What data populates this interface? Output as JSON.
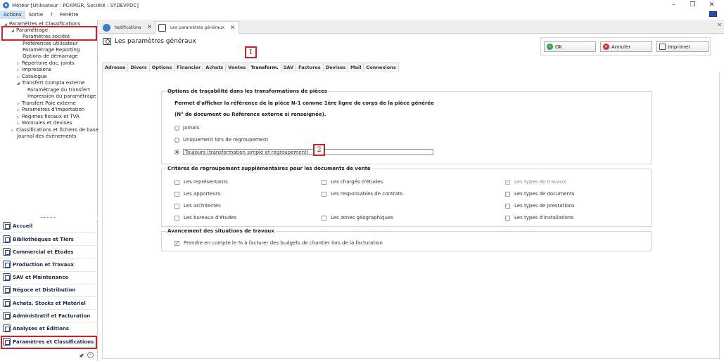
{
  "window": {
    "title": "Météor [Utilisateur : PCKMGR, Société : SYDEVPDC]",
    "minimize": "–",
    "maximize": "❐",
    "close": "✕"
  },
  "menu": {
    "items": [
      {
        "label": "Actions"
      },
      {
        "label": "Sortie"
      },
      {
        "label": "?"
      },
      {
        "label": "Fenêtre"
      }
    ]
  },
  "tree": {
    "rows": [
      {
        "label": "Paramètres et Classifications",
        "expander": "◢"
      },
      {
        "label": "Paramétrage",
        "expander": "◢"
      },
      {
        "label": "Paramètres société",
        "expander": ""
      },
      {
        "label": "Préférences utilisateur",
        "expander": ""
      },
      {
        "label": "Paramétrage Reporting",
        "expander": ""
      },
      {
        "label": "Options de démarrage",
        "expander": ""
      },
      {
        "label": "Répertoire doc. joints",
        "expander": "▷"
      },
      {
        "label": "Impressions",
        "expander": "▷"
      },
      {
        "label": "Catalogue",
        "expander": "▷"
      },
      {
        "label": "Transfert Compta externe",
        "expander": "◢"
      },
      {
        "label": "Paramétrage du transfert",
        "expander": ""
      },
      {
        "label": "Impression du paramétrage",
        "expander": ""
      },
      {
        "label": "Transfert Paie externe",
        "expander": "▷"
      },
      {
        "label": "Paramètres d'importation",
        "expander": "▷"
      },
      {
        "label": "Régimes fiscaux et TVA",
        "expander": "▷"
      },
      {
        "label": "Monnaies et devises",
        "expander": "▷"
      },
      {
        "label": "Classifications et fichiers de base",
        "expander": "▷"
      },
      {
        "label": "Journal des événements",
        "expander": ""
      }
    ]
  },
  "nav": {
    "items": [
      {
        "label": "Accueil"
      },
      {
        "label": "Bibliothèques et Tiers"
      },
      {
        "label": "Commercial et Études"
      },
      {
        "label": "Production et Travaux"
      },
      {
        "label": "SAV et Maintenance"
      },
      {
        "label": "Négoce et Distribution"
      },
      {
        "label": "Achats, Stocks et Matériel"
      },
      {
        "label": "Administratif et Facturation"
      },
      {
        "label": "Analyses et Éditions"
      },
      {
        "label": "Paramètres et Classifications"
      }
    ],
    "pin_glyph": "🖈",
    "collapse_glyph": "«"
  },
  "tabs": [
    {
      "label": "Notifications",
      "close": "✕"
    },
    {
      "label": "Les paramètres généraux",
      "close": "✕"
    }
  ],
  "tabstrip_close": "✕",
  "page": {
    "title": "Les paramètres généraux",
    "ok_label": "OK",
    "ok_glyph": "✓",
    "cancel_label": "Annuler",
    "cancel_glyph": "✕",
    "print_label": "Imprimer",
    "badge1": "1",
    "badge2": "2"
  },
  "subtabs": [
    {
      "label": "Adresse"
    },
    {
      "label": "Divers"
    },
    {
      "label": "Options"
    },
    {
      "label": "Financier"
    },
    {
      "label": "Achats"
    },
    {
      "label": "Ventes"
    },
    {
      "label": "Transform."
    },
    {
      "label": "SAV"
    },
    {
      "label": "Factures"
    },
    {
      "label": "Devises"
    },
    {
      "label": "Mail"
    },
    {
      "label": "Connexions"
    }
  ],
  "trace": {
    "legend": "Options de traçabilité dans les transformations de pièces",
    "desc1": "Permet d'afficher la référence de la pièce N-1 comme 1ère ligne de corps de la pièce générée",
    "desc2": "(N° de document ou Référence externe si renseignée).",
    "options": [
      {
        "label": "Jamais",
        "checked": false
      },
      {
        "label": "Uniquement lors de regroupement",
        "checked": false
      },
      {
        "label": "Toujours (transformation simple et regroupement)",
        "checked": true
      }
    ]
  },
  "criteria": {
    "legend": "Critères de regroupement supplémentaires pour les documents de vente",
    "check_glyph": "✓",
    "col1": [
      {
        "label": "Les représentants"
      },
      {
        "label": "Les apporteurs"
      },
      {
        "label": "Les architectes"
      },
      {
        "label": "Les bureaux d'études"
      }
    ],
    "col2": [
      {
        "label": "Les chargés d'études"
      },
      {
        "label": "Les responsables de contrats"
      },
      {
        "label": "Les zones géographiques"
      }
    ],
    "col3": [
      {
        "label": "Les types de travaux",
        "checked": true
      },
      {
        "label": "Les types de documents",
        "checked": false
      },
      {
        "label": "Les types de prestations",
        "checked": false
      },
      {
        "label": "Les types d'installations",
        "checked": false
      }
    ]
  },
  "progress": {
    "legend": "Avancement des situations de travaux",
    "option": "Prendre en compte le % à facturer des budgets de chantier lors de la facturation",
    "check_glyph": "✓"
  }
}
